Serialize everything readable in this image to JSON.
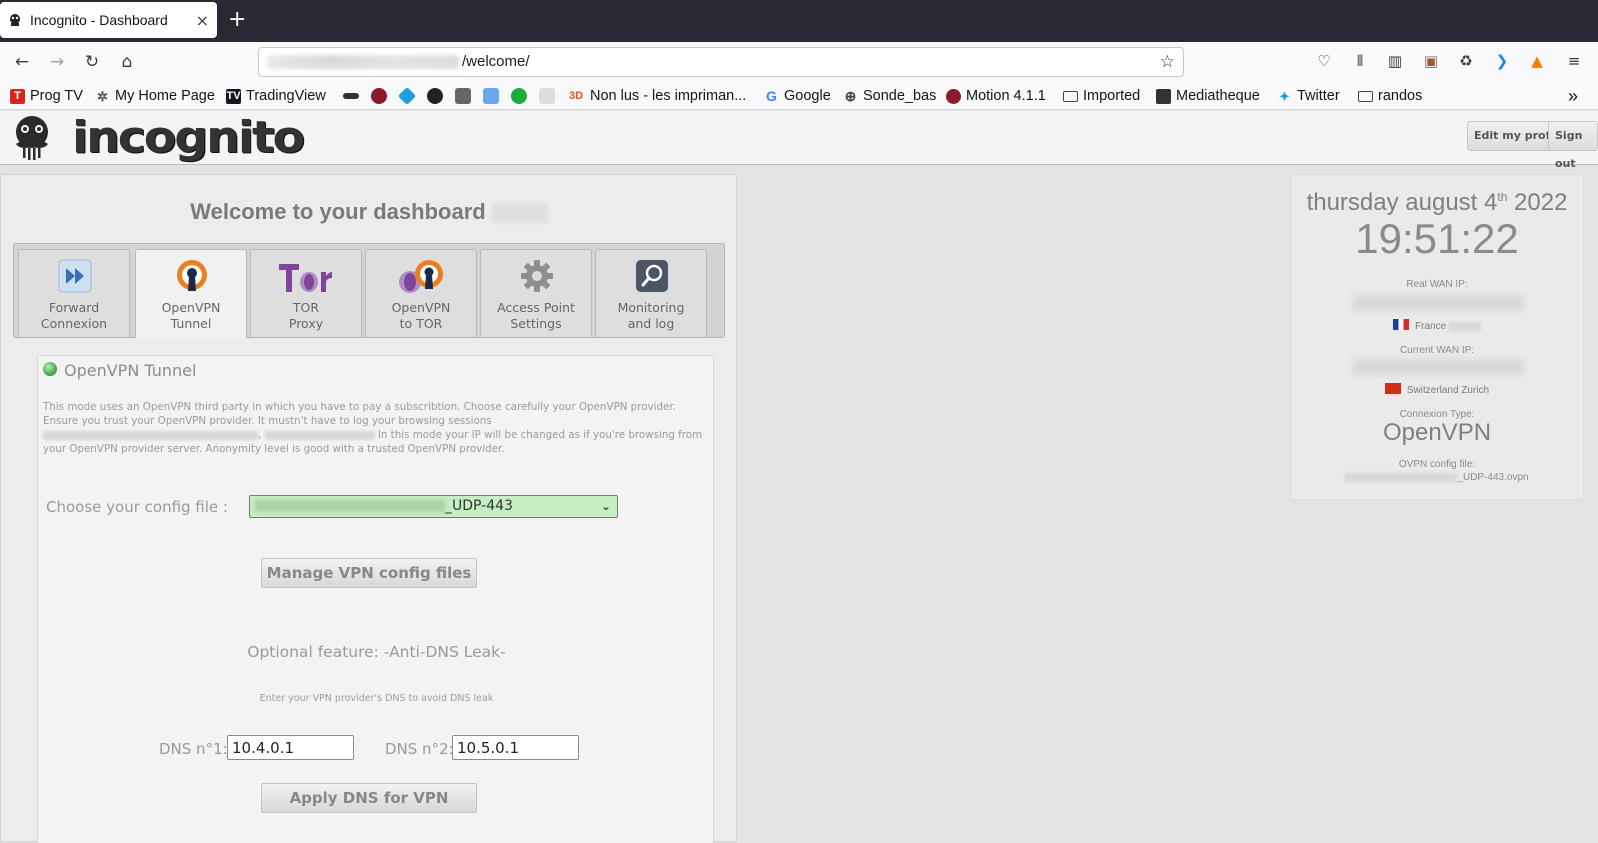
{
  "browser": {
    "tab_title": "Incognito - Dashboard",
    "tab_close": "×",
    "new_tab": "+",
    "url_suffix": "/welcome/",
    "bookmarks": [
      {
        "label": "Prog TV",
        "color": "#d8261c"
      },
      {
        "label": "My Home Page",
        "color": "#555555"
      },
      {
        "label": "TradingView",
        "color": "#131722"
      },
      {
        "label": "Non lus - les impriman...",
        "color": "#e2541a"
      },
      {
        "label": "Google",
        "color": "#4285f4"
      },
      {
        "label": "Sonde_bas",
        "color": "#444444"
      },
      {
        "label": "Motion 4.1.1",
        "color": "#8b1a2b"
      },
      {
        "label": "Imported",
        "color": "#444444"
      },
      {
        "label": "Mediatheque",
        "color": "#333333"
      },
      {
        "label": "Twitter",
        "color": "#1d9bf0"
      },
      {
        "label": "randos",
        "color": "#444444"
      }
    ],
    "overflow": "»"
  },
  "header": {
    "logo_text": "incognito",
    "edit_profile": "Edit my profil",
    "sign_out": "Sign out"
  },
  "dashboard": {
    "welcome": "Welcome to your dashboard",
    "modes": [
      {
        "label": "Forward\nConnexion",
        "active": false
      },
      {
        "label": "OpenVPN\nTunnel",
        "active": true
      },
      {
        "label": "TOR\nProxy",
        "active": false
      },
      {
        "label": "OpenVPN\nto TOR",
        "active": false
      },
      {
        "label": "Access Point\nSettings",
        "active": false
      },
      {
        "label": "Monitoring\nand log",
        "active": false
      }
    ],
    "panel_title": "OpenVPN Tunnel",
    "desc_1": "This mode uses an OpenVPN third party in which you have to pay a subscribtion. Choose carefully your OpenVPN provider. Ensure you trust your OpenVPN provider. It mustn't have to log your browsing sessions",
    "desc_2": "In this mode your IP will be changed as if you're browsing from your OpenVPN provider server. Anonymity level is good with a trusted OpenVPN provider.",
    "config_label": "Choose your config file :",
    "config_value_suffix": "_UDP-443",
    "manage_button": "Manage VPN config files",
    "optional_title": "Optional feature: -Anti-DNS Leak-",
    "optional_hint": "Enter your VPN provider's DNS to avoid DNS leak",
    "dns1_label": "DNS n°1:",
    "dns1_value": "10.4.0.1",
    "dns2_label": "DNS n°2:",
    "dns2_value": "10.5.0.1",
    "apply_button": "Apply DNS for VPN"
  },
  "widget": {
    "date_prefix": "thursday august 4",
    "date_sup": "th",
    "date_year": " 2022",
    "time": "19:51:22",
    "real_wan_label": "Real WAN IP:",
    "real_country": "France",
    "current_wan_label": "Current WAN IP:",
    "current_country": "Switzerland Zurich",
    "connexion_label": "Connexion Type:",
    "connexion_value": "OpenVPN",
    "ovpn_label": "OVPN config file:",
    "ovpn_value_suffix": "_UDP-443.ovpn"
  }
}
